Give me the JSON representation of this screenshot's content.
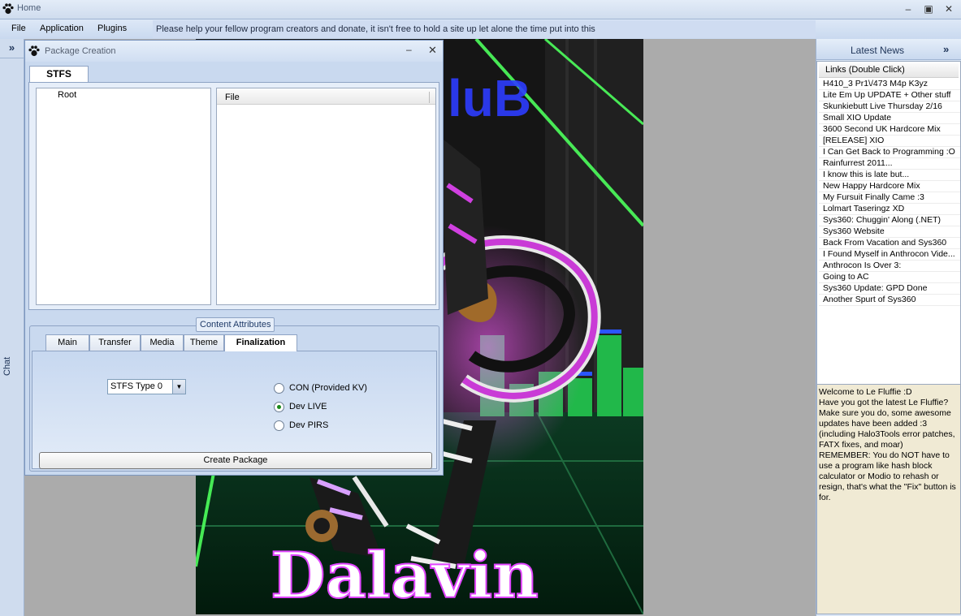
{
  "app": {
    "title": "Home"
  },
  "menu": {
    "items": [
      "File",
      "Application",
      "Plugins"
    ],
    "notice": "Please help your fellow program creators and donate, it isn't free to hold a site up let alone the time put into this"
  },
  "left_strip": {
    "label": "Chat",
    "expand_glyph": "»"
  },
  "package_window": {
    "title": "Package Creation",
    "tab": "STFS",
    "tree_root": "Root",
    "file_column": "File",
    "content_attributes_label": "Content Attributes",
    "tabs": [
      "Main",
      "Transfer",
      "Media",
      "Theme",
      "Finalization"
    ],
    "active_tab": "Finalization",
    "stfs_type": "STFS Type 0",
    "radio_options": [
      {
        "label": "CON (Provided KV)",
        "checked": false
      },
      {
        "label": "Dev LIVE",
        "checked": true
      },
      {
        "label": "Dev PIRS",
        "checked": false
      }
    ],
    "create_button": "Create Package"
  },
  "art": {
    "sign_text": "luB",
    "name_text": "Dalavin"
  },
  "right_panel": {
    "title": "Latest News",
    "expand_glyph": "»",
    "list_header": "Links (Double Click)",
    "news": [
      "H410_3 Pr1\\/473 M4p K3yz",
      "Lite Em Up UPDATE + Other stuff",
      "Skunkiebutt Live Thursday 2/16",
      "Small XIO Update",
      "3600 Second UK Hardcore Mix",
      "[RELEASE] XIO",
      "I Can Get Back to Programming :O",
      "Rainfurrest 2011...",
      "I know this is late but...",
      "New Happy Hardcore Mix",
      "My Fursuit Finally Came :3",
      "Lolmart Taseringz XD",
      "Sys360: Chuggin' Along (.NET)",
      "Sys360 Website",
      "Back From Vacation and Sys360",
      "I Found Myself in Anthrocon Vide...",
      "Anthrocon Is Over 3:",
      "Going to AC",
      "Sys360 Update: GPD Done",
      "Another Spurt of Sys360"
    ],
    "welcome_text": "Welcome to Le Fluffie :D\nHave you got the latest Le Fluffie?\nMake sure you do, some awesome updates have been added :3 (including Halo3Tools error patches, FATX fixes, and moar)\nREMEMBER: You do NOT have to use a program like hash block calculator or Modio to rehash or resign, that's what the \"Fix\" button is for."
  },
  "colors": {
    "chrome": "#dbe6f4",
    "workspace": "#ababab",
    "neon_green": "#2bd14a",
    "neon_pink": "#e040ff"
  }
}
